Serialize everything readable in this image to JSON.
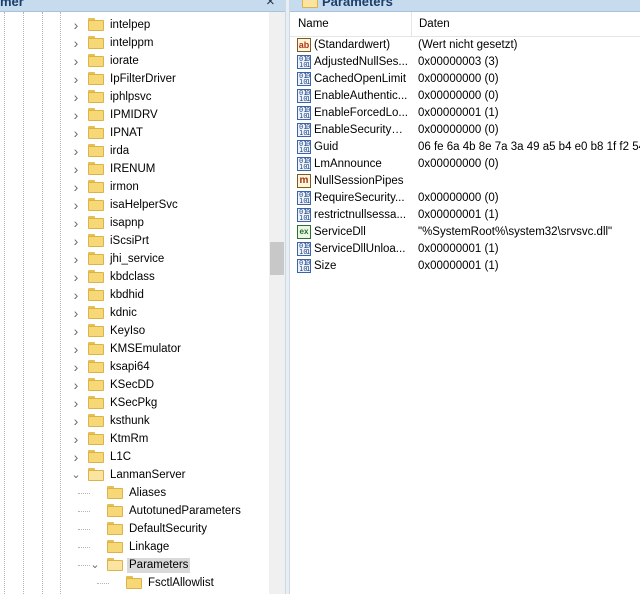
{
  "left_pane": {
    "title": "mer",
    "close_glyph": "×",
    "tree_items": [
      {
        "label": "intelpep",
        "expandable": true
      },
      {
        "label": "intelppm",
        "expandable": true
      },
      {
        "label": "iorate",
        "expandable": true
      },
      {
        "label": "IpFilterDriver",
        "expandable": true
      },
      {
        "label": "iphlpsvc",
        "expandable": true
      },
      {
        "label": "IPMIDRV",
        "expandable": true
      },
      {
        "label": "IPNAT",
        "expandable": true
      },
      {
        "label": "irda",
        "expandable": true
      },
      {
        "label": "IRENUM",
        "expandable": true
      },
      {
        "label": "irmon",
        "expandable": true
      },
      {
        "label": "isaHelperSvc",
        "expandable": true
      },
      {
        "label": "isapnp",
        "expandable": true
      },
      {
        "label": "iScsiPrt",
        "expandable": true
      },
      {
        "label": "jhi_service",
        "expandable": true
      },
      {
        "label": "kbdclass",
        "expandable": true
      },
      {
        "label": "kbdhid",
        "expandable": true
      },
      {
        "label": "kdnic",
        "expandable": true
      },
      {
        "label": "KeyIso",
        "expandable": true
      },
      {
        "label": "KMSEmulator",
        "expandable": true
      },
      {
        "label": "ksapi64",
        "expandable": true
      },
      {
        "label": "KSecDD",
        "expandable": true
      },
      {
        "label": "KSecPkg",
        "expandable": true
      },
      {
        "label": "ksthunk",
        "expandable": true
      },
      {
        "label": "KtmRm",
        "expandable": true
      },
      {
        "label": "L1C",
        "expandable": true
      },
      {
        "label": "LanmanServer",
        "expanded": true
      },
      {
        "label": "Aliases",
        "level": 1
      },
      {
        "label": "AutotunedParameters",
        "level": 1
      },
      {
        "label": "DefaultSecurity",
        "level": 1
      },
      {
        "label": "Linkage",
        "level": 1
      },
      {
        "label": "Parameters",
        "level": 1,
        "expanded": true,
        "selected": true
      },
      {
        "label": "FsctlAllowlist",
        "level": 2
      }
    ]
  },
  "right_pane": {
    "title": "Parameters",
    "columns": {
      "name": "Name",
      "data": "Daten"
    },
    "values": [
      {
        "icon": "string-value-icon",
        "name": "(Standardwert)",
        "data": "(Wert nicht gesetzt)"
      },
      {
        "icon": "dword-value-icon",
        "name": "AdjustedNullSes...",
        "data": "0x00000003 (3)"
      },
      {
        "icon": "dword-value-icon",
        "name": "CachedOpenLimit",
        "data": "0x00000000 (0)"
      },
      {
        "icon": "dword-value-icon",
        "name": "EnableAuthentic...",
        "data": "0x00000000 (0)"
      },
      {
        "icon": "dword-value-icon",
        "name": "EnableForcedLo...",
        "data": "0x00000001 (1)"
      },
      {
        "icon": "dword-value-icon",
        "name": "EnableSecuritySi...",
        "data": "0x00000000 (0)"
      },
      {
        "icon": "binary-value-icon",
        "name": "Guid",
        "data": "06 fe 6a 4b 8e 7a 3a 49 a5 b4 e0 b8 1f f2 54"
      },
      {
        "icon": "dword-value-icon",
        "name": "LmAnnounce",
        "data": "0x00000000 (0)"
      },
      {
        "icon": "multi-string-value-icon",
        "name": "NullSessionPipes",
        "data": ""
      },
      {
        "icon": "dword-value-icon",
        "name": "RequireSecurity...",
        "data": "0x00000000 (0)"
      },
      {
        "icon": "dword-value-icon",
        "name": "restrictnullsessa...",
        "data": "0x00000001 (1)"
      },
      {
        "icon": "expand-string-value-icon",
        "name": "ServiceDll",
        "data": "\"%SystemRoot%\\system32\\srvsvc.dll\""
      },
      {
        "icon": "dword-value-icon",
        "name": "ServiceDllUnloa...",
        "data": "0x00000001 (1)"
      },
      {
        "icon": "dword-value-icon",
        "name": "Size",
        "data": "0x00000001 (1)"
      }
    ]
  },
  "colors": {
    "header_bg": "#c7dbef",
    "folder": "#f6d877",
    "selection": "#d9d9d9"
  }
}
